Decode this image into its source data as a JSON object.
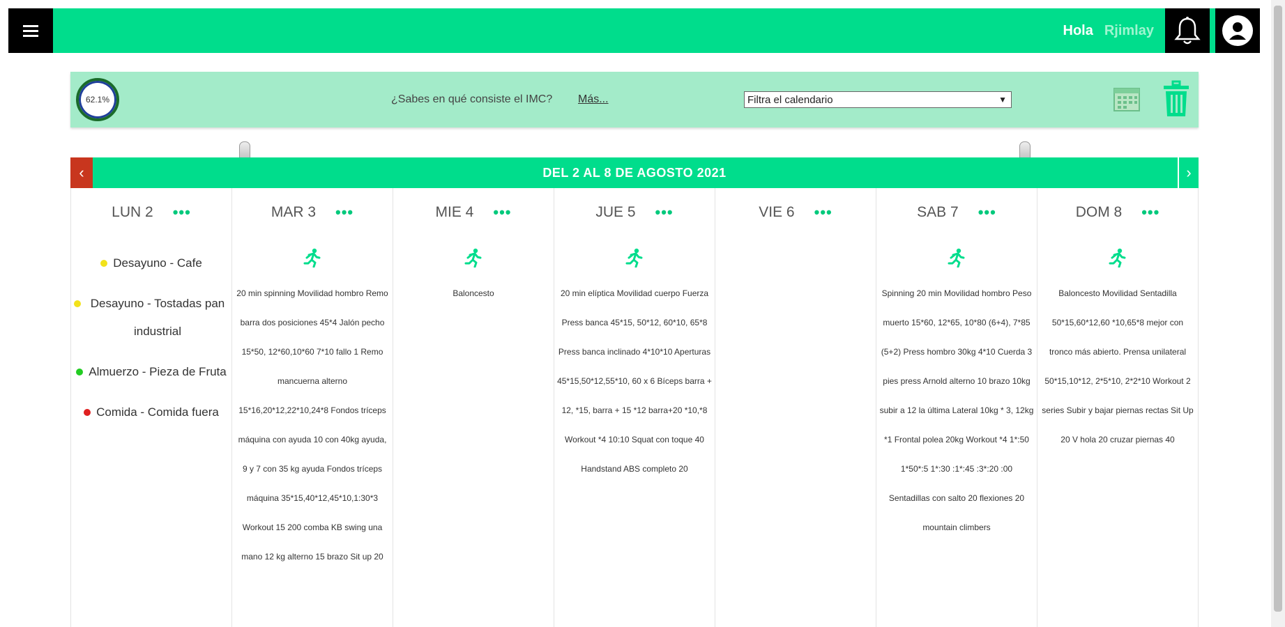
{
  "header": {
    "greeting": "Hola",
    "username": "Rjimlay",
    "menu_icon": "hamburger-icon",
    "bell_icon": "bell-icon",
    "user_icon": "user-icon",
    "accent_color": "#00dd8c"
  },
  "info_bar": {
    "progress_text": "62.1%",
    "imc_question": "¿Sabes en qué consiste el IMC?",
    "imc_more_link": "Más...",
    "filter_selected": "Filtra el calendario",
    "calendar_icon": "calendar-icon",
    "trash_icon": "trash-icon"
  },
  "week": {
    "title": "DEL 2 AL 8 DE AGOSTO 2021",
    "prev_label": "‹",
    "next_label": "›"
  },
  "days": [
    {
      "name": "LUN 2",
      "menu": "•••",
      "meals": [
        {
          "text": "Desayuno - Cafe",
          "color": "#f2e21a"
        },
        {
          "text": "Desayuno - Tostadas pan industrial",
          "color": "#f2e21a"
        },
        {
          "text": "Almuerzo - Pieza de Fruta",
          "color": "#22cc22"
        },
        {
          "text": "Comida - Comida fuera",
          "color": "#e02020"
        }
      ]
    },
    {
      "name": "MAR 3",
      "menu": "•••",
      "activity_icon": "running-icon",
      "workout": "20 min spinning Movilidad hombro Remo barra dos posiciones 45*4 Jalón pecho 15*50, 12*60,10*60 7*10 fallo 1 Remo mancuerna alterno 15*16,20*12,22*10,24*8 Fondos tríceps máquina con ayuda 10 con 40kg ayuda, 9 y 7 con 35 kg ayuda Fondos tríceps máquina 35*15,40*12,45*10,1:30*3 Workout 15 200 comba KB swing una mano 12 kg alterno 15 brazo Sit up 20"
    },
    {
      "name": "MIE 4",
      "menu": "•••",
      "activity_icon": "running-icon",
      "workout": "Baloncesto"
    },
    {
      "name": "JUE 5",
      "menu": "•••",
      "activity_icon": "running-icon",
      "workout": "20 min elíptica Movilidad cuerpo Fuerza Press banca 45*15, 50*12, 60*10, 65*8 Press banca inclinado 4*10*10 Aperturas 45*15,50*12,55*10, 60 x 6 Bíceps barra + 12, *15, barra + 15 *12 barra+20 *10,*8 Workout *4 10:10 Squat con toque 40 Handstand ABS completo 20"
    },
    {
      "name": "VIE 6",
      "menu": "•••",
      "workout": ""
    },
    {
      "name": "SAB 7",
      "menu": "•••",
      "activity_icon": "running-icon",
      "workout": "Spinning 20 min Movilidad hombro Peso muerto 15*60, 12*65, 10*80 (6+4), 7*85 (5+2) Press hombro 30kg 4*10 Cuerda 3 pies press Arnold alterno 10 brazo 10kg subir a 12 la última Lateral 10kg * 3, 12kg *1 Frontal polea 20kg Workout *4 1*:50 1*50*:5 1*:30 :1*:45 :3*:20 :00 Sentadillas con salto 20 flexiones 20 mountain climbers"
    },
    {
      "name": "DOM 8",
      "menu": "•••",
      "activity_icon": "running-icon",
      "workout": "Baloncesto Movilidad Sentadilla 50*15,60*12,60 *10,65*8 mejor con tronco más abierto. Prensa unilateral 50*15,10*12, 2*5*10, 2*2*10 Workout 2 series Subir y bajar piernas rectas Sit Up 20 V hola 20 cruzar piernas 40"
    }
  ]
}
